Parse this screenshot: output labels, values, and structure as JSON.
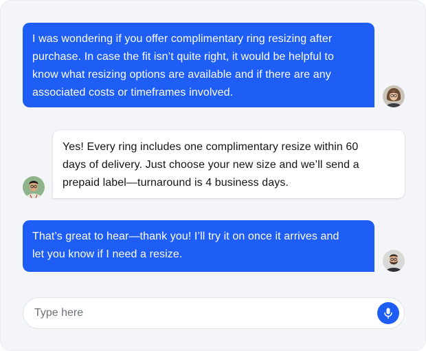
{
  "colors": {
    "accent": "#1f5ef5",
    "panel_bg": "#f4f5f8",
    "agent_bubble_bg": "#ffffff"
  },
  "messages": [
    {
      "role": "user",
      "lines": [
        "I was wondering if you offer complimentary ring resizing after",
        "purchase. In case the fit isn’t quite right, it would be helpful to",
        "know what resizing options are available and if there are any",
        "associated costs or timeframes involved."
      ],
      "avatar_icon": "woman-avatar-icon"
    },
    {
      "role": "agent",
      "lines": [
        "Yes! Every ring includes one complimentary resize within 60",
        "days of delivery. Just choose your new size and we’ll send a",
        "prepaid label—turnaround is 4 business days."
      ],
      "avatar_icon": "man-avatar-icon"
    },
    {
      "role": "user",
      "lines": [
        "That’s great to hear—thank you! I’ll try it on once it arrives and",
        "let you know if I need a resize."
      ],
      "avatar_icon": "bearded-man-avatar-icon"
    }
  ],
  "composer": {
    "placeholder": "Type here",
    "mic_icon": "microphone-icon"
  }
}
